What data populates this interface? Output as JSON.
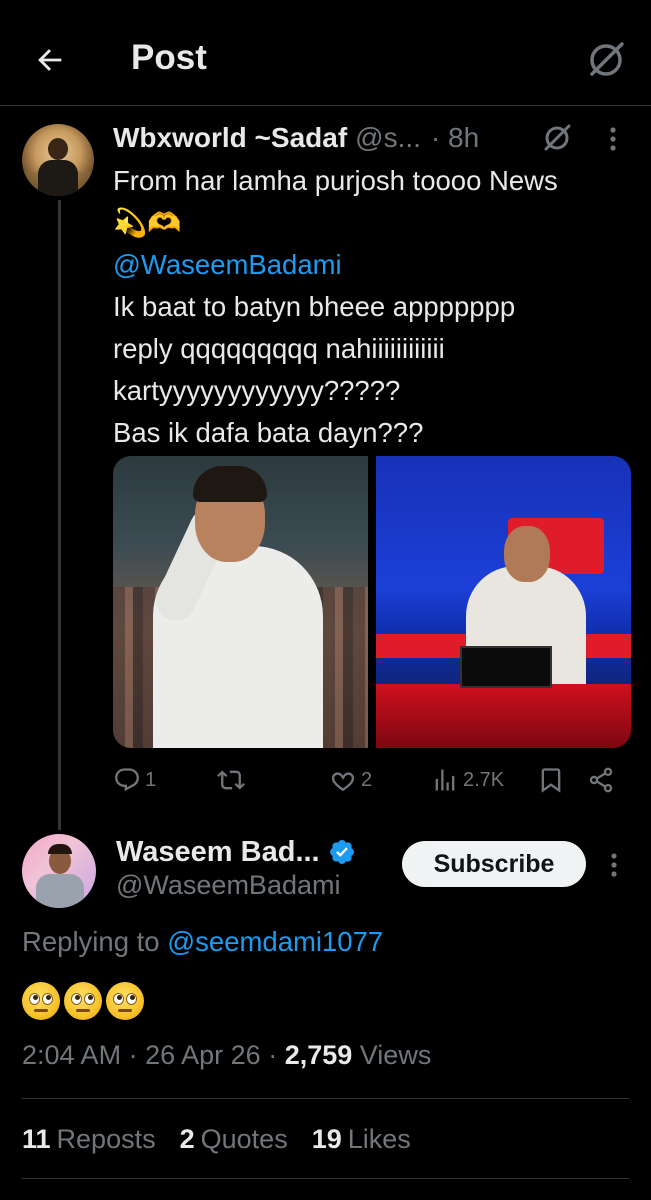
{
  "header": {
    "title": "Post"
  },
  "parent_tweet": {
    "author_name": "Wbxworld ~Sadaf",
    "handle": "@s...",
    "time": "· 8h",
    "lines": [
      "From har lamha purjosh toooo News",
      "💫🫶",
      "@WaseemBadami",
      "Ik baat to batyn bheee appppppp",
      "reply qqqqqqqqq nahiiiiiiiiiiii",
      "kartyyyyyyyyyyyy?????",
      "Bas ik dafa bata dayn???"
    ],
    "actions": {
      "replies": "1",
      "reposts": "",
      "likes": "2",
      "views": "2.7K"
    }
  },
  "main_tweet": {
    "author_name": "Waseem Bad...",
    "handle": "@WaseemBadami",
    "subscribe_label": "Subscribe",
    "replying_prefix": "Replying to ",
    "replying_to": "@seemdami1077",
    "time": "2:04 AM",
    "date": "26 Apr 26",
    "views_count": "2,759",
    "views_label": "Views"
  },
  "stats": {
    "reposts_count": "11",
    "reposts_label": "Reposts",
    "quotes_count": "2",
    "quotes_label": "Quotes",
    "likes_count": "19",
    "likes_label": "Likes"
  },
  "colors": {
    "background": "#000000",
    "text": "#e7e9ea",
    "secondary": "#71767b",
    "link": "#1d9bf0"
  }
}
